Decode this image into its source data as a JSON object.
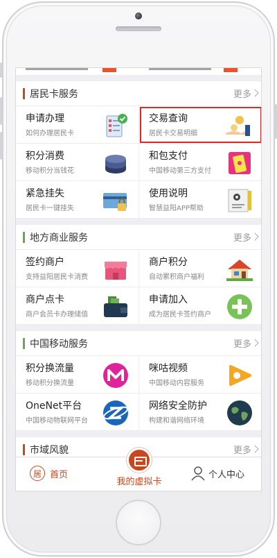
{
  "sections": [
    {
      "title": "居民卡服务",
      "more": "更多",
      "accent": "#c9471f",
      "items": [
        {
          "label": "申请办理",
          "sub": "如何办理居民卡",
          "icon": "application-form-icon"
        },
        {
          "label": "交易查询",
          "sub": "居民卡交易明细",
          "icon": "coin-hand-icon",
          "highlighted": true
        },
        {
          "label": "积分消费",
          "sub": "移动积分当钱花",
          "icon": "points-stack-icon"
        },
        {
          "label": "和包支付",
          "sub": "中国移动第三方支付",
          "icon": "mobile-wallet-icon"
        },
        {
          "label": "紧急挂失",
          "sub": "居民卡一键挂失",
          "icon": "card-lock-icon"
        },
        {
          "label": "使用说明",
          "sub": "智慧益阳APP帮助",
          "icon": "manual-gear-icon"
        }
      ]
    },
    {
      "title": "地方商业服务",
      "more": "更多",
      "accent": "#6aa84f",
      "items": [
        {
          "label": "签约商户",
          "sub": "支持益阳居民卡消费",
          "icon": "store-icon"
        },
        {
          "label": "商户积分",
          "sub": "自动累积商户福利",
          "icon": "house-icon"
        },
        {
          "label": "商户点卡",
          "sub": "商户会员卡办理储值",
          "icon": "wallet-icon"
        },
        {
          "label": "申请加入",
          "sub": "成为居民卡签约商户",
          "icon": "plus-icon"
        }
      ]
    },
    {
      "title": "中国移动服务",
      "more": "更多",
      "accent": "#6aa84f",
      "items": [
        {
          "label": "积分换流量",
          "sub": "移动积分换流量",
          "icon": "m-logo-icon"
        },
        {
          "label": "咪咕视频",
          "sub": "中国移动内容服务",
          "icon": "migu-video-icon"
        },
        {
          "label": "OneNet平台",
          "sub": "中国移动物联网平台",
          "icon": "onenet-logo-icon"
        },
        {
          "label": "网络安全防护",
          "sub": "构建和谐网络环境",
          "icon": "globe-icon"
        }
      ]
    },
    {
      "title": "市域风貌",
      "more": "更多",
      "accent": "#c9471f",
      "items": []
    }
  ],
  "tabbar": {
    "home_label": "首页",
    "home_glyph": "居",
    "card_label": "我的虚拟卡",
    "me_label": "个人中心",
    "active_color": "#c9471f"
  }
}
